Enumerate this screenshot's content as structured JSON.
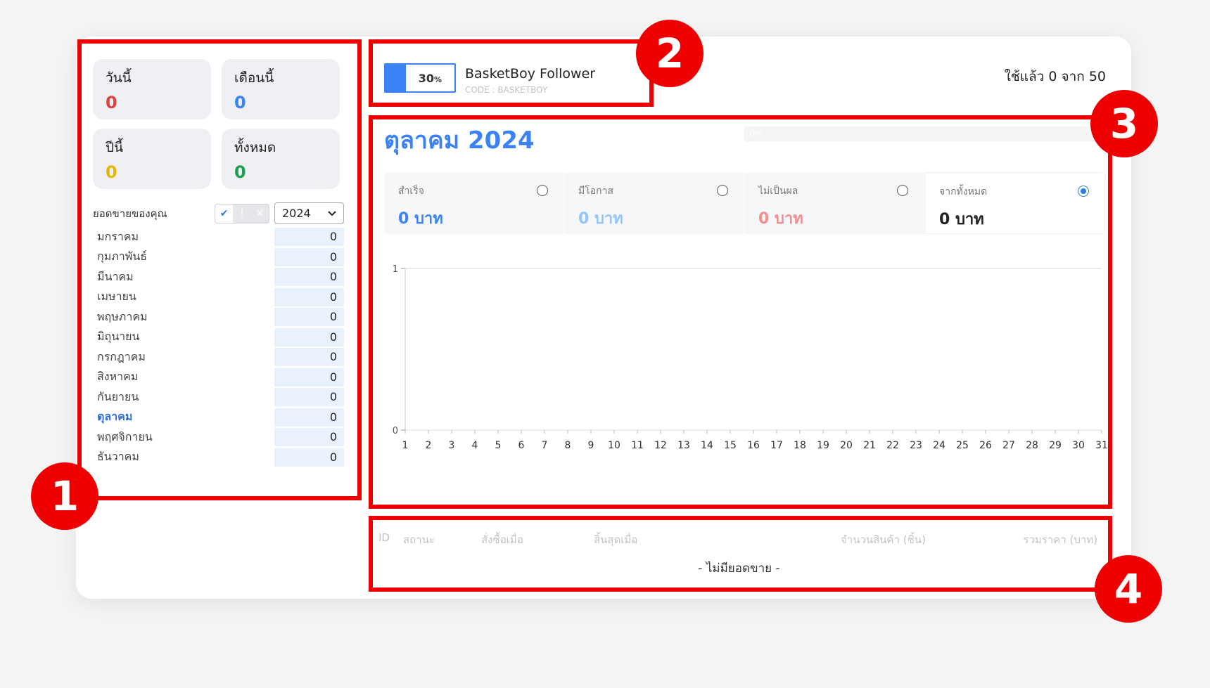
{
  "stats": {
    "today": {
      "label": "วันนี้",
      "value": "0",
      "color": "#e04040"
    },
    "month": {
      "label": "เดือนนี้",
      "value": "0",
      "color": "#3b82f6"
    },
    "year": {
      "label": "ปีนี้",
      "value": "0",
      "color": "#e5b800"
    },
    "total": {
      "label": "ทั้งหมด",
      "value": "0",
      "color": "#1f9d55"
    }
  },
  "sales": {
    "header": "ยอดขายของคุณ",
    "filter_icons": [
      "check-icon",
      "exclamation-icon",
      "x-icon"
    ],
    "filter_glyphs": [
      "✔",
      "!",
      "✕"
    ],
    "year_selected": "2024",
    "months": [
      {
        "name": "มกราคม",
        "value": "0"
      },
      {
        "name": "กุมภาพันธ์",
        "value": "0"
      },
      {
        "name": "มีนาคม",
        "value": "0"
      },
      {
        "name": "เมษายน",
        "value": "0"
      },
      {
        "name": "พฤษภาคม",
        "value": "0"
      },
      {
        "name": "มิถุนายน",
        "value": "0"
      },
      {
        "name": "กรกฎาคม",
        "value": "0"
      },
      {
        "name": "สิงหาคม",
        "value": "0"
      },
      {
        "name": "กันยายน",
        "value": "0"
      },
      {
        "name": "ตุลาคม",
        "value": "0"
      },
      {
        "name": "พฤศจิกายน",
        "value": "0"
      },
      {
        "name": "ธันวาคม",
        "value": "0"
      }
    ],
    "active_month_index": 9
  },
  "package": {
    "progress_percent": 30,
    "progress_label": "30",
    "progress_unit": "%",
    "name": "BasketBoy Follower",
    "code": "CODE : BASKETBOY",
    "usage": "ใช้แล้ว 0 จาก 50"
  },
  "period": {
    "title": "ตุลาคม 2024",
    "mini_progress_label": "0%"
  },
  "summary": [
    {
      "label": "สำเร็จ",
      "value": "0 บาท",
      "color": "#3b82f6",
      "selected": false
    },
    {
      "label": "มีโอกาส",
      "value": "0 บาท",
      "color": "#93c5fd",
      "selected": false
    },
    {
      "label": "ไม่เป็นผล",
      "value": "0 บาท",
      "color": "#ef8f8f",
      "selected": false
    },
    {
      "label": "จากทั้งหมด",
      "value": "0 บาท",
      "color": "#222222",
      "selected": true
    }
  ],
  "chart_data": {
    "type": "line",
    "x": [
      1,
      2,
      3,
      4,
      5,
      6,
      7,
      8,
      9,
      10,
      11,
      12,
      13,
      14,
      15,
      16,
      17,
      18,
      19,
      20,
      21,
      22,
      23,
      24,
      25,
      26,
      27,
      28,
      29,
      30,
      31
    ],
    "series": [],
    "ylim": [
      0,
      1
    ],
    "yticks": [
      "0",
      "1"
    ],
    "grid": true
  },
  "table": {
    "columns": [
      "ID",
      "สถานะ",
      "สั่งซื้อเมื่อ",
      "สิ้นสุดเมื่อ",
      "จำนวนสินค้า (ชิ้น)",
      "รวมราคา (บาท)"
    ],
    "empty_message": "- ไม่มียอดขาย -"
  },
  "badges": [
    "1",
    "2",
    "3",
    "4"
  ]
}
